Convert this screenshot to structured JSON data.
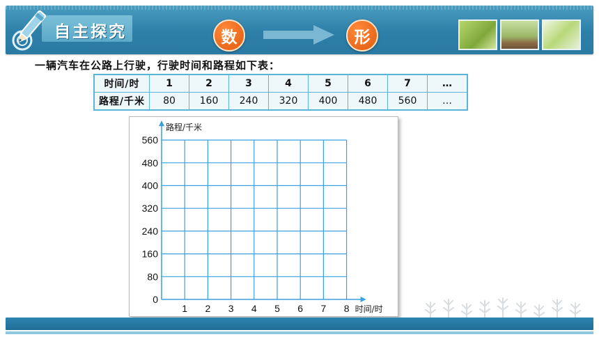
{
  "header": {
    "title": "自主探究",
    "badge_left": "数",
    "badge_right": "形"
  },
  "question": "一辆汽车在公路上行驶，行驶时间和路程如下表：",
  "table": {
    "row_headers": [
      "时间/时",
      "路程/千米"
    ],
    "times": [
      "1",
      "2",
      "3",
      "4",
      "5",
      "6",
      "7",
      "…"
    ],
    "distances": [
      "80",
      "160",
      "240",
      "320",
      "400",
      "480",
      "560",
      "…"
    ]
  },
  "chart_data": {
    "type": "scatter",
    "xlabel": "时间/时",
    "ylabel": "路程/千米",
    "x_ticks": [
      1,
      2,
      3,
      4,
      5,
      6,
      7,
      8
    ],
    "y_ticks": [
      0,
      80,
      160,
      240,
      320,
      400,
      480,
      560
    ],
    "xlim": [
      0,
      8
    ],
    "ylim": [
      0,
      560
    ],
    "grid": true,
    "series": []
  },
  "colors": {
    "header": "#2e7fa8",
    "badge": "#f06d1e",
    "grid": "#3aa0e0",
    "table_border": "#5ab4d6"
  }
}
